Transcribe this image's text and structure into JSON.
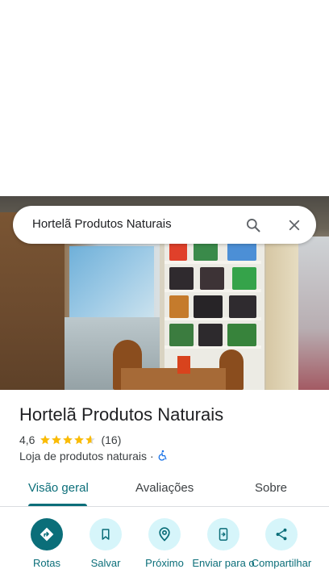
{
  "search": {
    "query": "Hortelã Produtos Naturais",
    "icons": {
      "search": "search-icon",
      "close": "close-icon"
    }
  },
  "photo": {
    "icon": "storefront-photo"
  },
  "place": {
    "name": "Hortelã Produtos Naturais",
    "rating": "4,6",
    "rating_value": 4.6,
    "rating_max": 5,
    "review_count": "(16)",
    "category": "Loja de produtos naturais",
    "separator": "·",
    "accessibility_icon": "wheelchair-icon"
  },
  "tabs": [
    {
      "label": "Visão geral",
      "active": true
    },
    {
      "label": "Avaliações",
      "active": false
    },
    {
      "label": "Sobre",
      "active": false
    }
  ],
  "actions": [
    {
      "label": "Rotas",
      "icon": "directions-icon"
    },
    {
      "label": "Salvar",
      "icon": "bookmark-icon"
    },
    {
      "label": "Próximo",
      "icon": "nearby-icon"
    },
    {
      "label": "Enviar para o",
      "icon": "send-to-phone-icon"
    },
    {
      "label": "Compartilhar",
      "icon": "share-icon"
    }
  ],
  "colors": {
    "accent": "#0b6e79",
    "action_bg": "#d6f5fa",
    "star": "#fbbc04",
    "accessibility": "#1a73e8"
  }
}
